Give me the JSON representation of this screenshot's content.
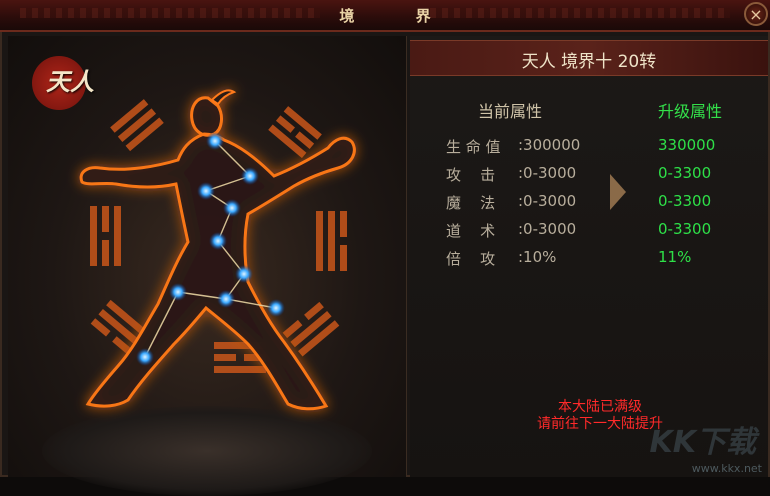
{
  "window": {
    "title": "境 界",
    "close_label": "×"
  },
  "emblem": {
    "char": "天人"
  },
  "realm": {
    "title": "天人 境界十 20转"
  },
  "columns": {
    "current": "当前属性",
    "next": "升级属性"
  },
  "attributes": [
    {
      "label": "生 命 值",
      "current": ":300000",
      "next": "330000"
    },
    {
      "label": "攻    击",
      "current": ":0-3000",
      "next": "0-3300"
    },
    {
      "label": "魔    法",
      "current": ":0-3000",
      "next": "0-3300"
    },
    {
      "label": "道    术",
      "current": ":0-3000",
      "next": "0-3300"
    },
    {
      "label": "倍    攻",
      "current": ":10%",
      "next": "11%"
    }
  ],
  "notice": {
    "line1": "本大陆已满级",
    "line2": "请前往下一大陆提升"
  },
  "watermark": {
    "logo": "KK下载",
    "url": "www.kkx.net"
  },
  "colors": {
    "upgrade_green": "#2ee048",
    "notice_red": "#ff2a2a",
    "glow_orange": "#ff7a1a",
    "node_blue": "#3aa8ff"
  }
}
